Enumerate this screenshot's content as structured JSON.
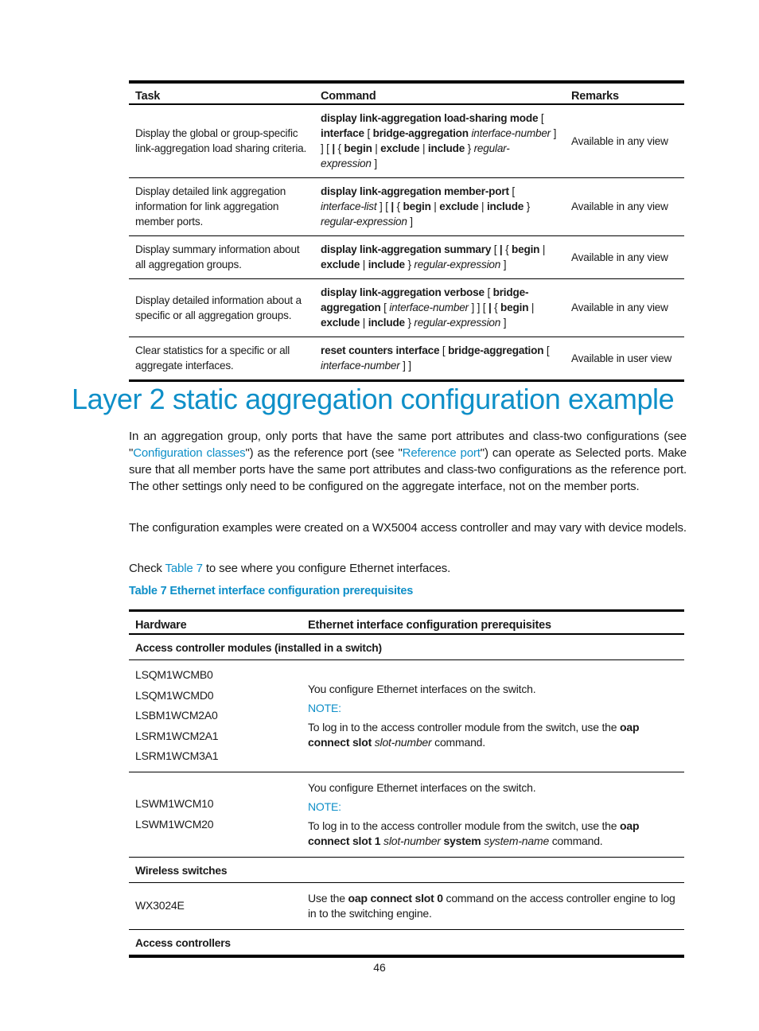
{
  "command_table": {
    "headers": [
      "Task",
      "Command",
      "Remarks"
    ],
    "rows": [
      {
        "task": "Display the global or group-specific link-aggregation load sharing criteria.",
        "command_parts": [
          {
            "t": "display link-aggregation load-sharing mode",
            "s": "b"
          },
          {
            "t": " [ ",
            "s": "n"
          },
          {
            "t": "interface",
            "s": "b"
          },
          {
            "t": " [ ",
            "s": "n"
          },
          {
            "t": "bridge-aggregation",
            "s": "b"
          },
          {
            "t": " interface-number",
            "s": "i"
          },
          {
            "t": " ] ] [ ",
            "s": "n"
          },
          {
            "t": "|",
            "s": "b"
          },
          {
            "t": " { ",
            "s": "n"
          },
          {
            "t": "begin",
            "s": "b"
          },
          {
            "t": " | ",
            "s": "n"
          },
          {
            "t": "exclude",
            "s": "b"
          },
          {
            "t": " | ",
            "s": "n"
          },
          {
            "t": "include",
            "s": "b"
          },
          {
            "t": " } ",
            "s": "n"
          },
          {
            "t": "regular-expression",
            "s": "i"
          },
          {
            "t": " ]",
            "s": "n"
          }
        ],
        "remarks": "Available in any view"
      },
      {
        "task": "Display detailed link aggregation information for link aggregation member ports.",
        "command_parts": [
          {
            "t": "display link-aggregation member-port",
            "s": "b"
          },
          {
            "t": " [ ",
            "s": "n"
          },
          {
            "t": "interface-list",
            "s": "i"
          },
          {
            "t": " ] [ ",
            "s": "n"
          },
          {
            "t": "|",
            "s": "b"
          },
          {
            "t": " { ",
            "s": "n"
          },
          {
            "t": "begin",
            "s": "b"
          },
          {
            "t": " | ",
            "s": "n"
          },
          {
            "t": "exclude",
            "s": "b"
          },
          {
            "t": " | ",
            "s": "n"
          },
          {
            "t": "include",
            "s": "b"
          },
          {
            "t": " } ",
            "s": "n"
          },
          {
            "t": "regular-expression",
            "s": "i"
          },
          {
            "t": " ]",
            "s": "n"
          }
        ],
        "remarks": "Available in any view"
      },
      {
        "task": "Display summary information about all aggregation groups.",
        "command_parts": [
          {
            "t": "display link-aggregation summary",
            "s": "b"
          },
          {
            "t": " [ ",
            "s": "n"
          },
          {
            "t": "|",
            "s": "b"
          },
          {
            "t": " { ",
            "s": "n"
          },
          {
            "t": "begin",
            "s": "b"
          },
          {
            "t": " | ",
            "s": "n"
          },
          {
            "t": "exclude",
            "s": "b"
          },
          {
            "t": " | ",
            "s": "n"
          },
          {
            "t": "include",
            "s": "b"
          },
          {
            "t": " } ",
            "s": "n"
          },
          {
            "t": "regular-expression",
            "s": "i"
          },
          {
            "t": " ]",
            "s": "n"
          }
        ],
        "remarks": "Available in any view"
      },
      {
        "task": "Display detailed information about a specific or all aggregation groups.",
        "command_parts": [
          {
            "t": "display link-aggregation verbose",
            "s": "b"
          },
          {
            "t": " [ ",
            "s": "n"
          },
          {
            "t": "bridge-aggregation",
            "s": "b"
          },
          {
            "t": " [ ",
            "s": "n"
          },
          {
            "t": "interface-number",
            "s": "i"
          },
          {
            "t": " ] ] [ ",
            "s": "n"
          },
          {
            "t": "|",
            "s": "b"
          },
          {
            "t": " { ",
            "s": "n"
          },
          {
            "t": "begin",
            "s": "b"
          },
          {
            "t": " | ",
            "s": "n"
          },
          {
            "t": "exclude",
            "s": "b"
          },
          {
            "t": " | ",
            "s": "n"
          },
          {
            "t": "include",
            "s": "b"
          },
          {
            "t": " } ",
            "s": "n"
          },
          {
            "t": "regular-expression",
            "s": "i"
          },
          {
            "t": " ]",
            "s": "n"
          }
        ],
        "remarks": "Available in any view"
      },
      {
        "task": "Clear statistics for a specific or all aggregate interfaces.",
        "command_parts": [
          {
            "t": "reset counters interface",
            "s": "b"
          },
          {
            "t": " [ ",
            "s": "n"
          },
          {
            "t": "bridge-aggregation",
            "s": "b"
          },
          {
            "t": " [ ",
            "s": "n"
          },
          {
            "t": "interface-number",
            "s": "i"
          },
          {
            "t": " ] ]",
            "s": "n"
          }
        ],
        "remarks": "Available in user view"
      }
    ]
  },
  "section": {
    "title": "Layer 2 static aggregation configuration example",
    "para1": {
      "t1": "In an aggregation group, only ports that have the same port attributes and class-two configurations (see \"",
      "link1": "Configuration classes",
      "t2": "\") as the reference port (see \"",
      "link2": "Reference port",
      "t3": "\") can operate as Selected ports. Make sure that all member ports have the same port attributes and class-two configurations as the reference port. The other settings only need to be configured on the aggregate interface, not on the member ports."
    },
    "para2": "The configuration examples were created on a WX5004 access controller and may vary with device models.",
    "para3": {
      "t1": "Check ",
      "link": "Table 7",
      "t2": " to see where you configure Ethernet interfaces."
    },
    "table_caption": "Table 7 Ethernet interface configuration prerequisites"
  },
  "prereq_table": {
    "headers": [
      "Hardware",
      "Ethernet interface configuration prerequisites"
    ],
    "group1_label": "Access controller modules (installed in a switch)",
    "block1": {
      "hardware": [
        "LSQM1WCMB0",
        "LSQM1WCMD0",
        "LSBM1WCM2A0",
        "LSRM1WCM2A1",
        "LSRM1WCM3A1"
      ],
      "line1": "You configure Ethernet interfaces on the switch.",
      "note": "NOTE:",
      "note_parts": [
        {
          "t": "To log in to the access controller module from the switch, use the ",
          "s": "n"
        },
        {
          "t": "oap connect slot",
          "s": "b"
        },
        {
          "t": " slot-number",
          "s": "i"
        },
        {
          "t": " command.",
          "s": "n"
        }
      ]
    },
    "block2": {
      "hardware": [
        "LSWM1WCM10",
        "LSWM1WCM20"
      ],
      "line1": "You configure Ethernet interfaces on the switch.",
      "note": "NOTE:",
      "note_parts": [
        {
          "t": "To log in to the access controller module from the switch, use the ",
          "s": "n"
        },
        {
          "t": "oap connect slot 1",
          "s": "b"
        },
        {
          "t": " slot-number",
          "s": "i"
        },
        {
          "t": " system",
          "s": "b"
        },
        {
          "t": " system-name",
          "s": "i"
        },
        {
          "t": " command.",
          "s": "n"
        }
      ]
    },
    "group2_label": "Wireless switches",
    "block3": {
      "hardware": "WX3024E",
      "desc_parts": [
        {
          "t": "Use the ",
          "s": "n"
        },
        {
          "t": "oap connect slot 0",
          "s": "b"
        },
        {
          "t": " command on the access controller engine to log in to the switching engine.",
          "s": "n"
        }
      ]
    },
    "group3_label": "Access controllers"
  },
  "page_number": "46"
}
